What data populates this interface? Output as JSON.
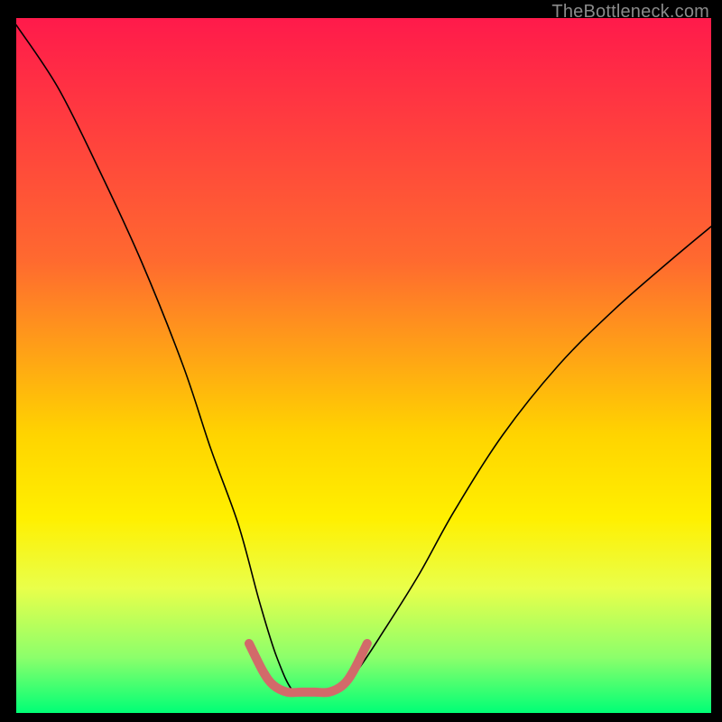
{
  "watermark": "TheBottleneck.com",
  "chart_data": {
    "type": "line",
    "title": "",
    "xlabel": "",
    "ylabel": "",
    "xlim": [
      0,
      100
    ],
    "ylim": [
      0,
      100
    ],
    "background_gradient_colors": [
      "#ff1a4b",
      "#ff6a2f",
      "#ffd400",
      "#fff000",
      "#e9ff4a",
      "#8cff6b",
      "#00ff76"
    ],
    "background_gradient_stops_pct": [
      0,
      35,
      60,
      72,
      82,
      92,
      100
    ],
    "series": [
      {
        "name": "bottleneck-curve",
        "x": [
          0,
          6,
          12,
          18,
          24,
          28,
          32,
          35,
          37.5,
          40,
          43,
          46,
          49,
          53,
          58,
          63,
          70,
          78,
          86,
          94,
          100
        ],
        "y": [
          99,
          90,
          78,
          65,
          50,
          38,
          27,
          16,
          8,
          3,
          3,
          3,
          6,
          12,
          20,
          29,
          40,
          50,
          58,
          65,
          70
        ],
        "stroke": "#000000",
        "stroke_width": 1.6
      },
      {
        "name": "highlight-range",
        "x": [
          33.5,
          35.5,
          37,
          39,
          41,
          43,
          45,
          47,
          48.5,
          50.5
        ],
        "y": [
          10,
          6,
          4,
          3,
          3,
          3,
          3,
          4,
          6,
          10
        ],
        "stroke": "#d26a6a",
        "stroke_width": 10,
        "linecap": "round"
      }
    ]
  }
}
